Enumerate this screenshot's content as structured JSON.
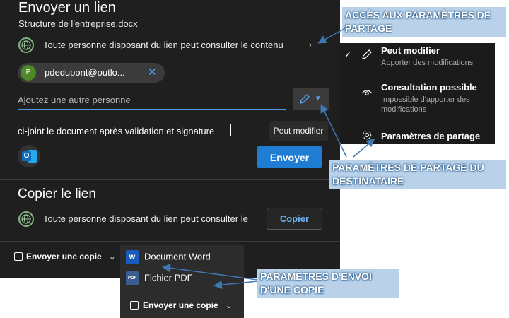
{
  "share_panel": {
    "title": "Envoyer un lien",
    "file_name": "Structure de l'entreprise.docx",
    "link_permission_text": "Toute personne disposant du lien peut consulter le contenu",
    "recipient": {
      "avatar_initial": "P",
      "email": "pdedupont@outlo..."
    },
    "add_person_placeholder": "Ajoutez une autre personne",
    "message_text": "ci-joint le document après validation et signature",
    "tooltip": "Peut modifier",
    "send_label": "Envoyer"
  },
  "copy_section": {
    "title": "Copier le lien",
    "permission_text": "Toute personne disposant du lien peut consulter le",
    "copy_label": "Copier"
  },
  "send_copy": {
    "label": "Envoyer une copie",
    "menu_items": [
      {
        "label": "Document Word",
        "badge": "W"
      },
      {
        "label": "Fichier PDF",
        "badge": "PDF"
      }
    ],
    "footer_label": "Envoyer une copie"
  },
  "permission_menu": {
    "items": [
      {
        "title": "Peut modifier",
        "description": "Apporter des modifications"
      },
      {
        "title": "Consultation possible",
        "description": "Impossible d'apporter des modifications"
      },
      {
        "title": "Paramètres de partage",
        "description": ""
      }
    ]
  },
  "callouts": {
    "sharing_settings": "ACCÈS AUX PARAMÈTRES DE PARTAGE",
    "recipient_settings": "PARAMÈTRES DE PARTAGE DU DESTINATAIRE",
    "send_copy_settings": "PARAMÈTRES D'ENVOI D'UNE COPIE"
  },
  "colors": {
    "panel_bg": "#1f1f1f",
    "accent_blue": "#1f7ed4",
    "callout_bg": "#b9d2ea",
    "word_blue": "#185abd",
    "pdf_red": "#c43e1c"
  }
}
